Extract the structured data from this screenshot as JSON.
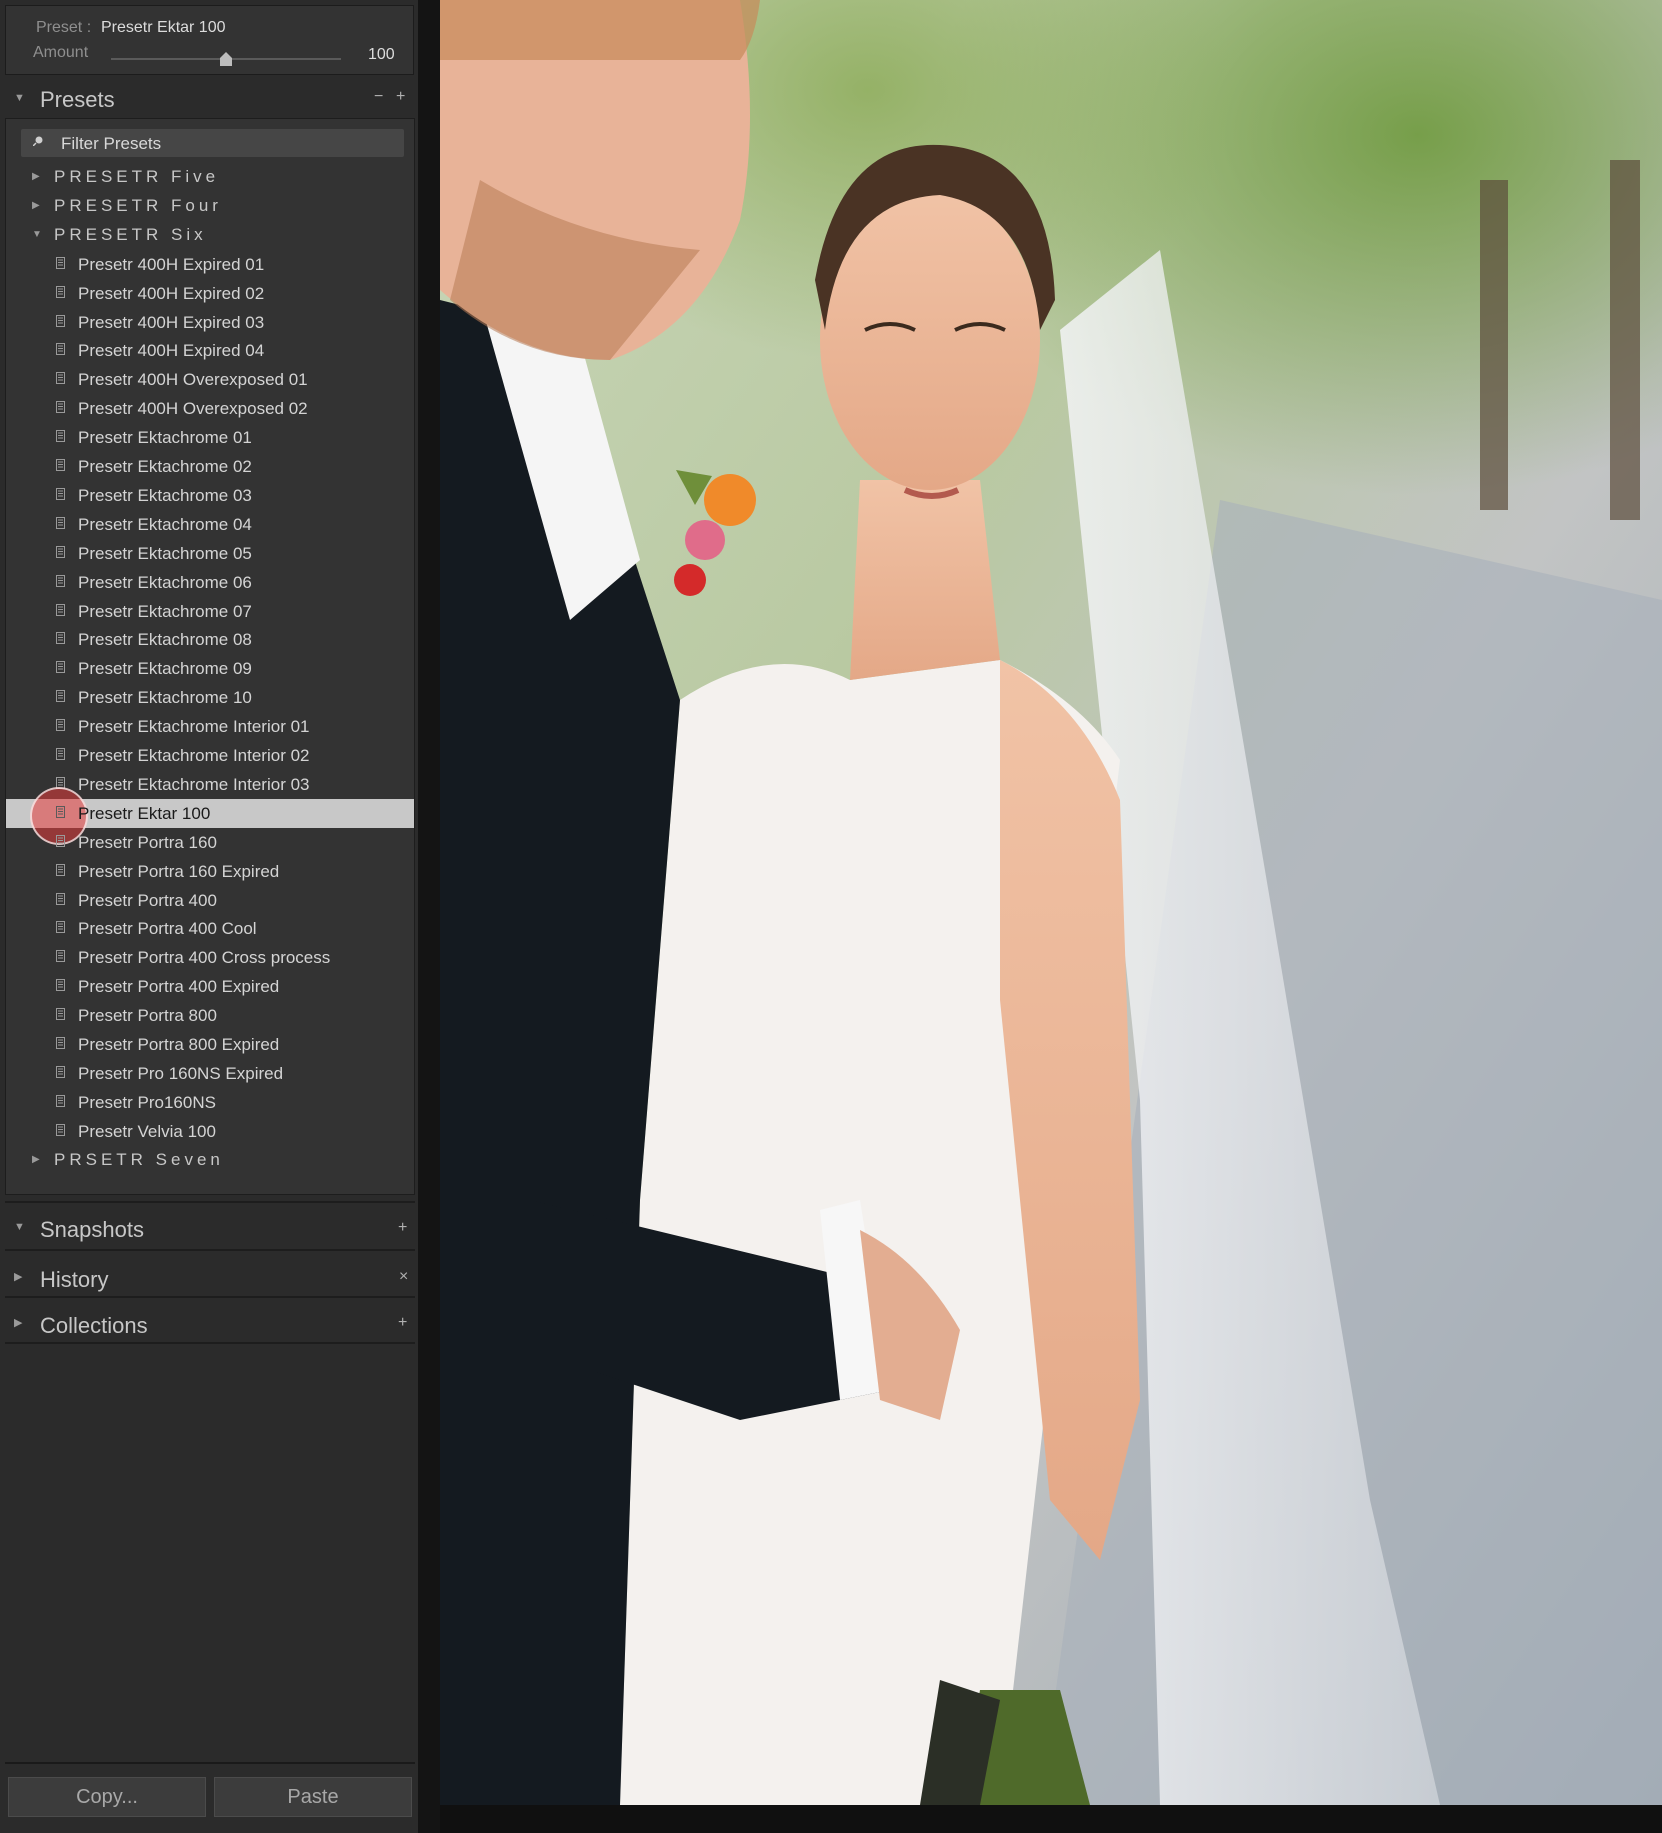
{
  "quick_develop": {
    "preset_label": "Preset :",
    "preset_value": "Presetr Ektar 100",
    "amount_label": "Amount",
    "amount_value": "100",
    "amount_fraction": 0.5
  },
  "presets_panel": {
    "title": "Presets",
    "minus_icon": "−",
    "plus_icon": "+",
    "filter_placeholder": "Filter Presets",
    "folders_top": [
      {
        "label": "PRESETR Five",
        "expanded": false
      },
      {
        "label": "PRESETR Four",
        "expanded": false
      },
      {
        "label": "PRESETR Six",
        "expanded": true
      }
    ],
    "items": [
      "Presetr 400H Expired 01",
      "Presetr 400H Expired 02",
      "Presetr 400H Expired 03",
      "Presetr 400H Expired 04",
      "Presetr 400H Overexposed 01",
      "Presetr 400H Overexposed 02",
      "Presetr Ektachrome 01",
      "Presetr Ektachrome 02",
      "Presetr Ektachrome 03",
      "Presetr Ektachrome 04",
      "Presetr Ektachrome 05",
      "Presetr Ektachrome 06",
      "Presetr Ektachrome 07",
      "Presetr Ektachrome 08",
      "Presetr Ektachrome 09",
      "Presetr Ektachrome 10",
      "Presetr Ektachrome Interior 01",
      "Presetr Ektachrome Interior 02",
      "Presetr Ektachrome Interior 03",
      "Presetr Ektar 100",
      "Presetr Portra 160",
      "Presetr Portra 160 Expired",
      "Presetr Portra 400",
      "Presetr Portra 400 Cool",
      "Presetr Portra 400 Cross process",
      "Presetr Portra 400 Expired",
      "Presetr Portra 800",
      "Presetr Portra 800 Expired",
      "Presetr Pro 160NS Expired",
      "Presetr Pro160NS",
      "Presetr Velvia 100"
    ],
    "selected_index": 19,
    "folder_bottom": {
      "label": "PRSETR Seven",
      "expanded": false
    }
  },
  "snapshots_panel": {
    "title": "Snapshots",
    "action_icon": "+"
  },
  "history_panel": {
    "title": "History",
    "action_icon": "×"
  },
  "collections_panel": {
    "title": "Collections",
    "action_icon": "+"
  },
  "buttons": {
    "copy": "Copy...",
    "paste": "Paste"
  },
  "colors": {
    "selected_row": "#c8c8c8",
    "panel_bg": "#333333",
    "sidebar_bg": "#2b2b2b"
  }
}
